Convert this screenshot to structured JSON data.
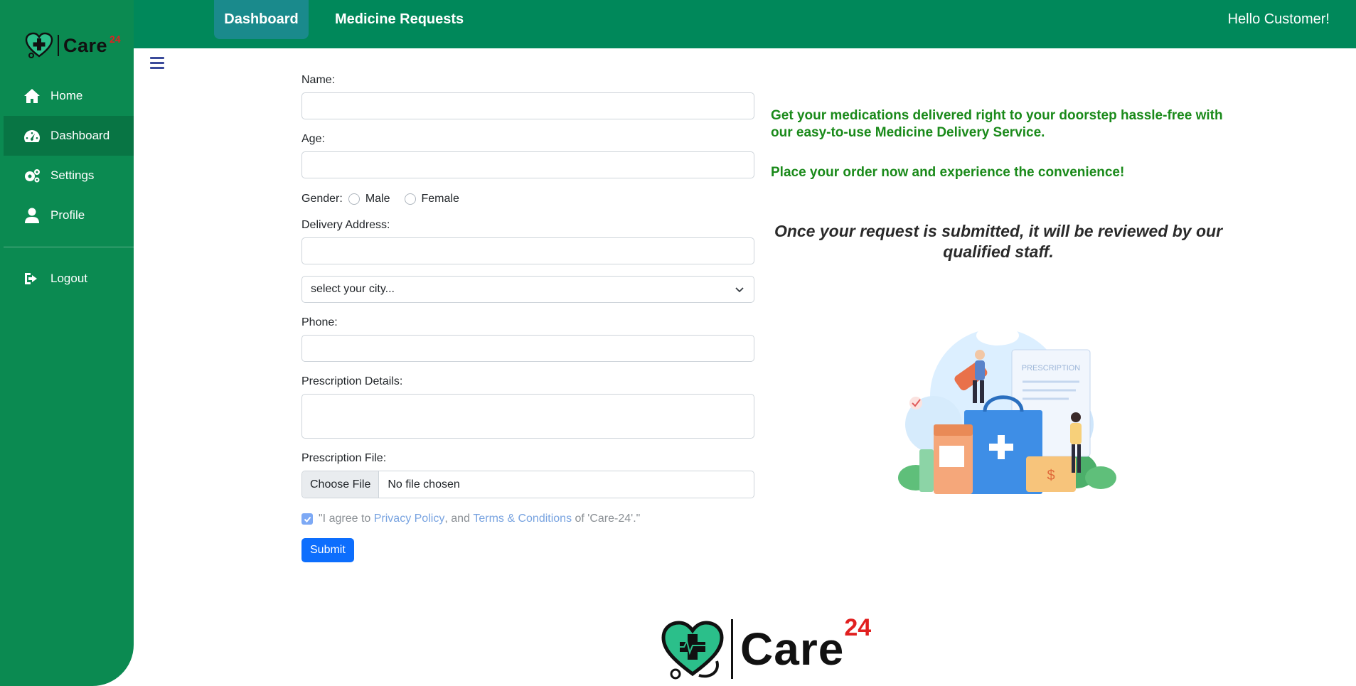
{
  "app": {
    "brand_word": "Care",
    "brand_sup": "24",
    "greeting": "Hello Customer!",
    "colors": {
      "sidebar": "#0b8a51",
      "topbar": "#00885a",
      "active_tab": "#1a8a8c",
      "accent_text": "#1a8a1a",
      "submit": "#0d6efd"
    }
  },
  "topbar": {
    "tabs": [
      {
        "label": "Dashboard",
        "active": true
      },
      {
        "label": "Medicine Requests",
        "active": false
      }
    ]
  },
  "sidebar": {
    "items": [
      {
        "label": "Home",
        "icon": "home-icon"
      },
      {
        "label": "Dashboard",
        "icon": "speedometer-icon",
        "active": true
      },
      {
        "label": "Settings",
        "icon": "gears-icon"
      },
      {
        "label": "Profile",
        "icon": "user-icon"
      }
    ],
    "logout": {
      "label": "Logout",
      "icon": "logout-icon"
    }
  },
  "form": {
    "name_label": "Name:",
    "age_label": "Age:",
    "gender_label": "Gender:",
    "gender_options": [
      "Male",
      "Female"
    ],
    "address_label": "Delivery Address:",
    "city_select_value": "select your city...",
    "phone_label": "Phone:",
    "prescription_details_label": "Prescription Details:",
    "prescription_file_label": "Prescription File:",
    "file_button": "Choose File",
    "file_status": "No file chosen",
    "agree_prefix": "\"I agree to ",
    "privacy_link": "Privacy Policy",
    "agree_mid": ", and ",
    "terms_link": "Terms & Conditions",
    "agree_suffix": " of 'Care-24'.\"",
    "agree_checked": true,
    "submit_label": "Submit"
  },
  "info": {
    "line1": "Get your medications delivered right to your doorstep hassle-free with our easy-to-use Medicine Delivery Service.",
    "line2": "Place your order now and experience the convenience!",
    "note": "Once your request is submitted, it will be reviewed by our qualified staff.",
    "illustration_text": "PRESCRIPTION"
  },
  "footer": {
    "brand_word": "Care",
    "brand_sup": "24"
  }
}
